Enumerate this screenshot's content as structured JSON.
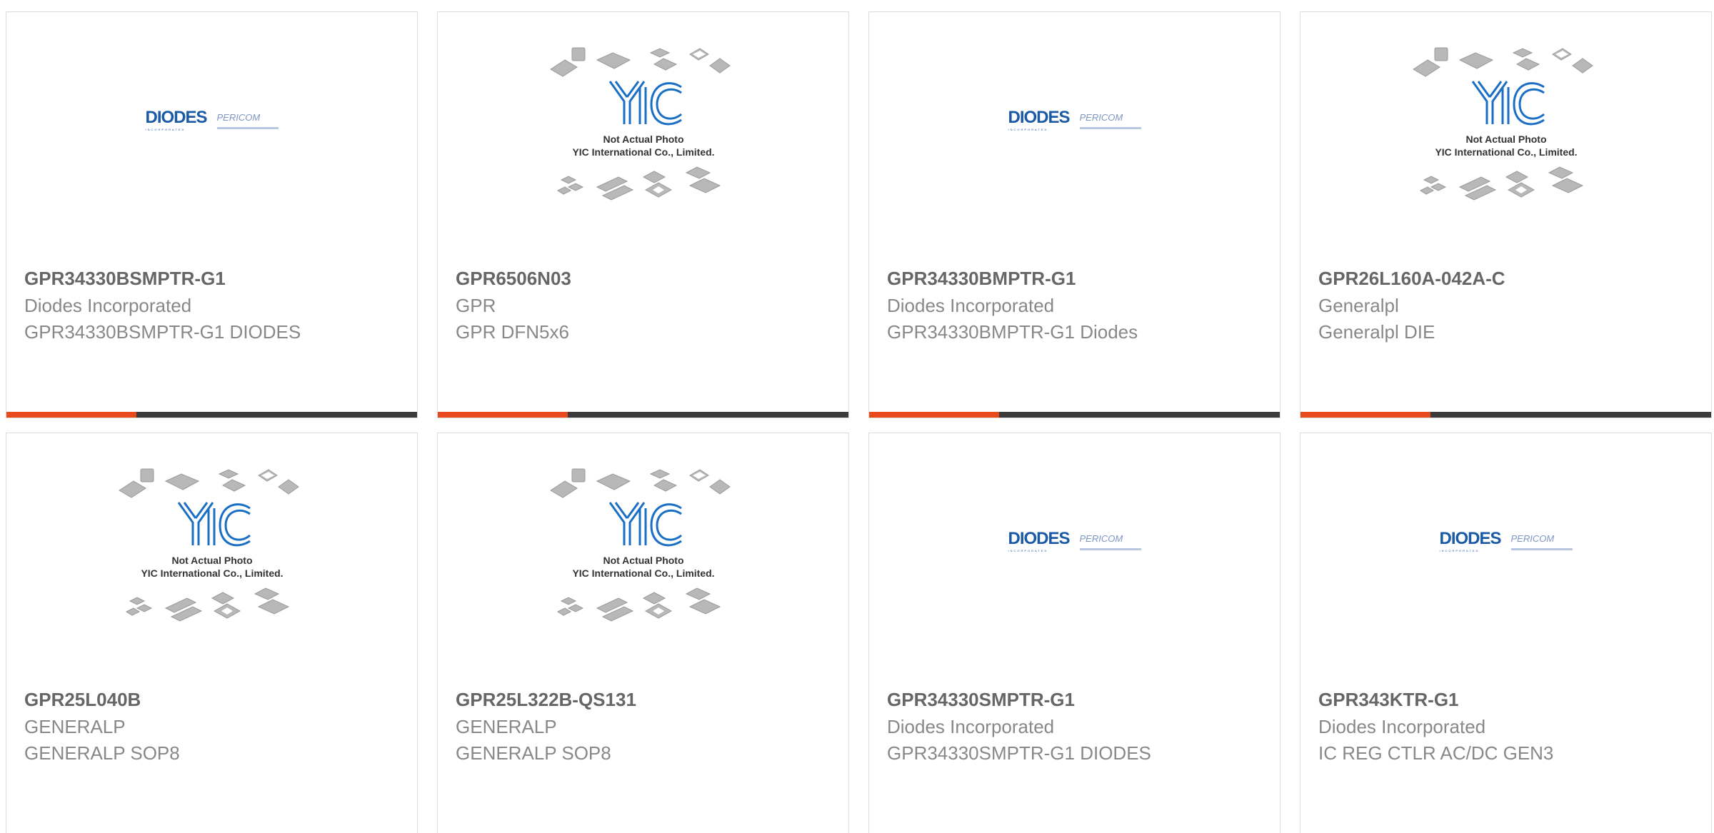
{
  "colors": {
    "accent": "#e8491d",
    "bar": "#3b3b3b",
    "title": "#666666",
    "text": "#888888",
    "yic_blue": "#1a6fc4",
    "diodes_blue": "#1b5aa6"
  },
  "logos": {
    "diodes": {
      "word": "DIODES",
      "sub": "INCORPORATED",
      "partner": "PERICOM"
    },
    "yic": {
      "line1": "Not Actual Photo",
      "line2": "YIC International Co., Limited."
    }
  },
  "products": [
    {
      "part": "GPR34330BSMPTR-G1",
      "manufacturer": "Diodes Incorporated",
      "description": "GPR34330BSMPTR-G1 DIODES",
      "image": "diodes-logo"
    },
    {
      "part": "GPR6506N03",
      "manufacturer": "GPR",
      "description": "GPR DFN5x6",
      "image": "yic-placeholder"
    },
    {
      "part": "GPR34330BMPTR-G1",
      "manufacturer": "Diodes Incorporated",
      "description": "GPR34330BMPTR-G1 Diodes",
      "image": "diodes-logo"
    },
    {
      "part": "GPR26L160A-042A-C",
      "manufacturer": "Generalpl",
      "description": "Generalpl DIE",
      "image": "yic-placeholder"
    },
    {
      "part": "GPR25L040B",
      "manufacturer": "GENERALP",
      "description": "GENERALP SOP8",
      "image": "yic-placeholder"
    },
    {
      "part": "GPR25L322B-QS131",
      "manufacturer": "GENERALP",
      "description": "GENERALP SOP8",
      "image": "yic-placeholder"
    },
    {
      "part": "GPR34330SMPTR-G1",
      "manufacturer": "Diodes Incorporated",
      "description": "GPR34330SMPTR-G1 DIODES",
      "image": "diodes-logo"
    },
    {
      "part": "GPR343KTR-G1",
      "manufacturer": "Diodes Incorporated",
      "description": "IC REG CTLR AC/DC GEN3",
      "image": "diodes-logo"
    }
  ]
}
